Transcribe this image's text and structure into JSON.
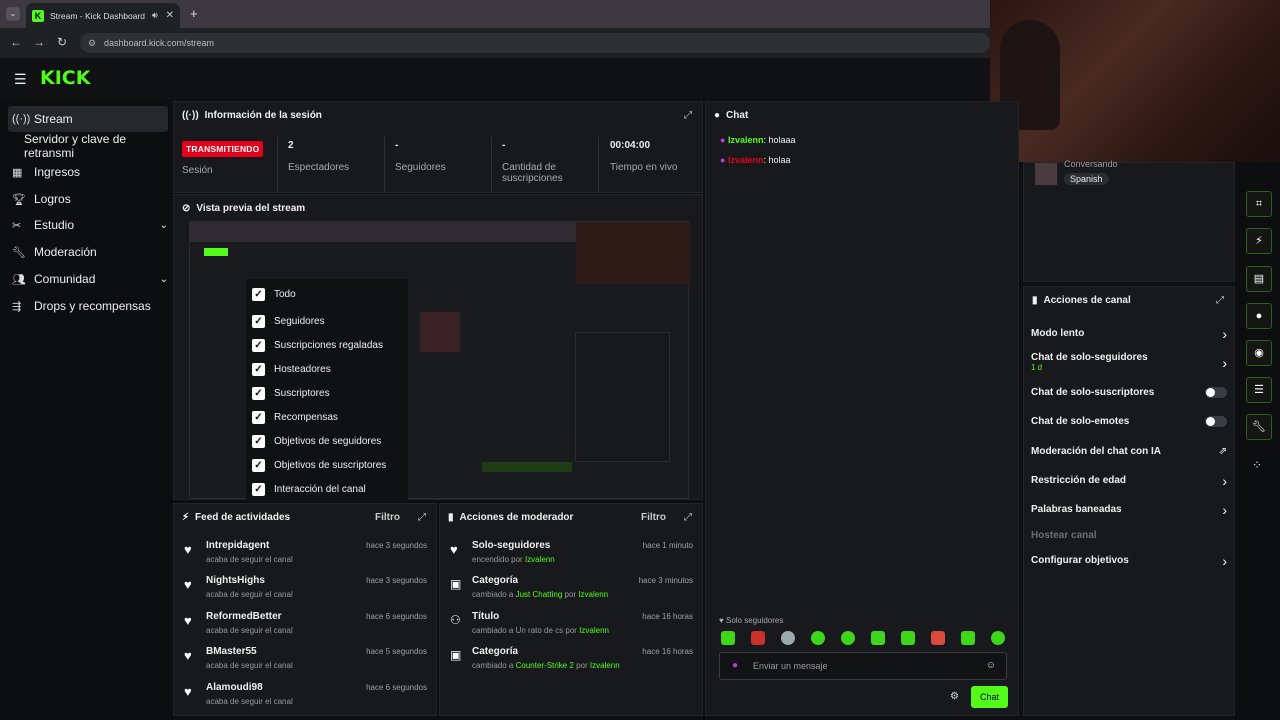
{
  "browser": {
    "tab_title": "Stream - Kick Dashboard",
    "url": "dashboard.kick.com/stream"
  },
  "brand": {
    "logo": "KICK",
    "accent": "#53fc18"
  },
  "sidebar": {
    "items": [
      {
        "label": "Stream",
        "icon": "broadcast-icon"
      },
      {
        "label": "Servidor y clave de retransmi"
      },
      {
        "label": "Ingresos",
        "icon": "chart-icon"
      },
      {
        "label": "Logros",
        "icon": "trophy-icon"
      },
      {
        "label": "Estudio",
        "icon": "tools-icon"
      },
      {
        "label": "Moderación",
        "icon": "wrench-icon"
      },
      {
        "label": "Comunidad",
        "icon": "people-icon"
      },
      {
        "label": "Drops y recompensas",
        "icon": "gift-icon"
      }
    ]
  },
  "session": {
    "title": "Información de la sesión",
    "live_badge": "TRANSMITIENDO",
    "session_label": "Sesión",
    "stats": [
      {
        "value": "2",
        "label": "Espectadores"
      },
      {
        "value": "-",
        "label": "Seguidores"
      },
      {
        "value": "-",
        "label": "Cantidad de suscripciones"
      },
      {
        "value": "00:04:00",
        "label": "Tiempo en vivo"
      }
    ]
  },
  "preview": {
    "title": "Vista previa del stream"
  },
  "filters": [
    "Todo",
    "Seguidores",
    "Suscripciones regaladas",
    "Hosteadores",
    "Suscriptores",
    "Recompensas",
    "Objetivos de seguidores",
    "Objetivos de suscriptores",
    "Interacción del canal"
  ],
  "feed": {
    "title": "Feed de actividades",
    "filter_label": "Filtro",
    "items": [
      {
        "name": "Intrepidagent",
        "sub": "acaba de seguir el canal",
        "time": "hace 3 segundos"
      },
      {
        "name": "NightsHighs",
        "sub": "acaba de seguir el canal",
        "time": "hace 3 segundos"
      },
      {
        "name": "ReformedBetter",
        "sub": "acaba de seguir el canal",
        "time": "hace 6 segundos"
      },
      {
        "name": "BMaster55",
        "sub": "acaba de seguir el canal",
        "time": "hace 5 segundos"
      },
      {
        "name": "Alamoudi98",
        "sub": "acaba de seguir el canal",
        "time": "hace 6 segundos"
      }
    ]
  },
  "modactions": {
    "title": "Acciones de moderador",
    "filter_label": "Filtro",
    "items": [
      {
        "name": "Solo-seguidores",
        "pre": "encendido por ",
        "hl": "Izvalenn",
        "post": "",
        "hl2": "",
        "time": "hace 1 minuto"
      },
      {
        "name": "Categoría",
        "pre": "cambiado a ",
        "hl": "Just Chatting",
        "post": " por ",
        "hl2": "Izvalenn",
        "time": "hace 3 minutos"
      },
      {
        "name": "Título",
        "pre": "cambiado a Un rato de cs por ",
        "hl": "Izvalenn",
        "post": "",
        "hl2": "",
        "time": "hace 16 horas"
      },
      {
        "name": "Categoría",
        "pre": "cambiado a ",
        "hl": "Counter-Strike 2",
        "post": " por ",
        "hl2": "Izvalenn",
        "time": "hace 16 horas"
      }
    ]
  },
  "chat": {
    "title": "Chat",
    "messages": [
      {
        "user": "Izvalenn",
        "text": ": holaaa"
      },
      {
        "user": "Izvalenn",
        "text": ": holaa"
      }
    ],
    "mode_label": "Solo seguidores",
    "placeholder": "Enviar un mensaje",
    "send_label": "Chat"
  },
  "conversation": {
    "label": "Conversando",
    "language": "Spanish"
  },
  "channel_actions": {
    "title": "Acciones de canal",
    "items": [
      {
        "label": "Modo lento",
        "type": "chevron"
      },
      {
        "label": "Chat de solo-seguidores",
        "sub": "1 d",
        "type": "chevron"
      },
      {
        "label": "Chat de solo-suscriptores",
        "type": "toggle"
      },
      {
        "label": "Chat de solo-emotes",
        "type": "toggle"
      },
      {
        "label": "Moderación del chat con IA",
        "type": "external"
      },
      {
        "label": "Restricción de edad",
        "type": "chevron"
      },
      {
        "label": "Palabras baneadas",
        "type": "chevron"
      },
      {
        "label": "Hostear canal",
        "type": "disabled"
      },
      {
        "label": "Configurar objetivos",
        "type": "chevron"
      }
    ]
  }
}
